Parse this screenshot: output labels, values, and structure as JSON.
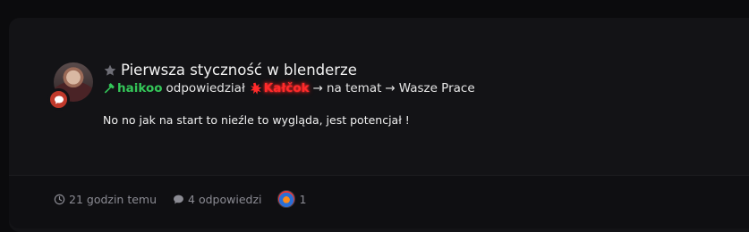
{
  "topic": {
    "title": "Pierwsza styczność w blenderze"
  },
  "activity": {
    "replier": "haikoo",
    "verb": "odpowiedział",
    "replied_to": "Kałčok",
    "arrow1": "→",
    "on_topic": "na temat",
    "arrow2": "→",
    "forum": "Wasze Prace"
  },
  "post": {
    "excerpt": "No no jak na start to nieźle to wygląda, jest potencjał !"
  },
  "stats": {
    "time_ago": "21 godzin temu",
    "replies": "4 odpowiedzi",
    "participants_count": "1"
  },
  "colors": {
    "replier": "#34c759",
    "replied_to": "#ff2a2a",
    "badge": "#c0392b"
  },
  "icons": {
    "star": "star-icon",
    "badge": "chat-bubble-icon",
    "replier": "hammer-icon",
    "replied_to": "splat-icon",
    "time": "clock-icon",
    "replies": "comment-icon"
  }
}
